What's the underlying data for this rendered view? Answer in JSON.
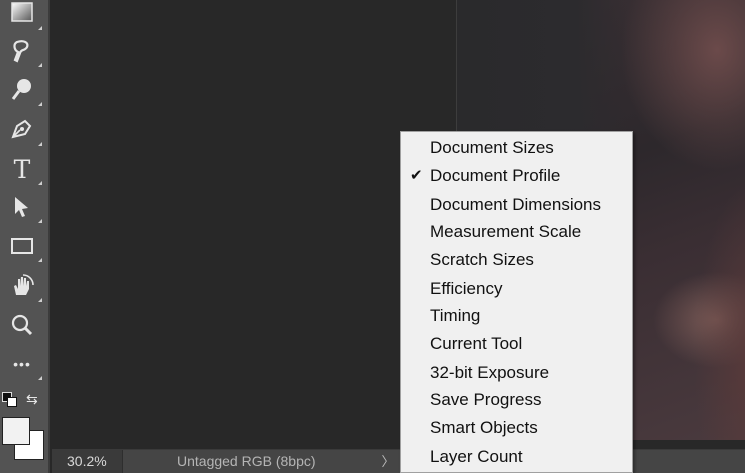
{
  "toolbar": {
    "tools": [
      {
        "icon": "gradient-icon"
      },
      {
        "icon": "smudge-icon"
      },
      {
        "icon": "dodge-icon"
      },
      {
        "icon": "pen-icon"
      },
      {
        "icon": "type-icon",
        "glyph": "T"
      },
      {
        "icon": "path-selection-icon"
      },
      {
        "icon": "rectangle-icon"
      },
      {
        "icon": "hand-rotate-icon"
      },
      {
        "icon": "zoom-icon"
      },
      {
        "icon": "more-icon",
        "glyph": "•••"
      }
    ],
    "colors": {
      "foreground": "#f2f2f2",
      "background": "#ffffff"
    }
  },
  "statusbar": {
    "zoom": "30.2%",
    "profile": "Untagged RGB (8bpc)",
    "arrow": "〉"
  },
  "menu": {
    "items": [
      {
        "label": "Document Sizes",
        "checked": false
      },
      {
        "label": "Document Profile",
        "checked": true
      },
      {
        "label": "Document Dimensions",
        "checked": false
      },
      {
        "label": "Measurement Scale",
        "checked": false
      },
      {
        "label": "Scratch Sizes",
        "checked": false
      },
      {
        "label": "Efficiency",
        "checked": false
      },
      {
        "label": "Timing",
        "checked": false
      },
      {
        "label": "Current Tool",
        "checked": false
      },
      {
        "label": "32-bit Exposure",
        "checked": false
      },
      {
        "label": "Save Progress",
        "checked": false
      },
      {
        "label": "Smart Objects",
        "checked": false
      },
      {
        "label": "Layer Count",
        "checked": false
      }
    ],
    "check_glyph": "✔"
  }
}
